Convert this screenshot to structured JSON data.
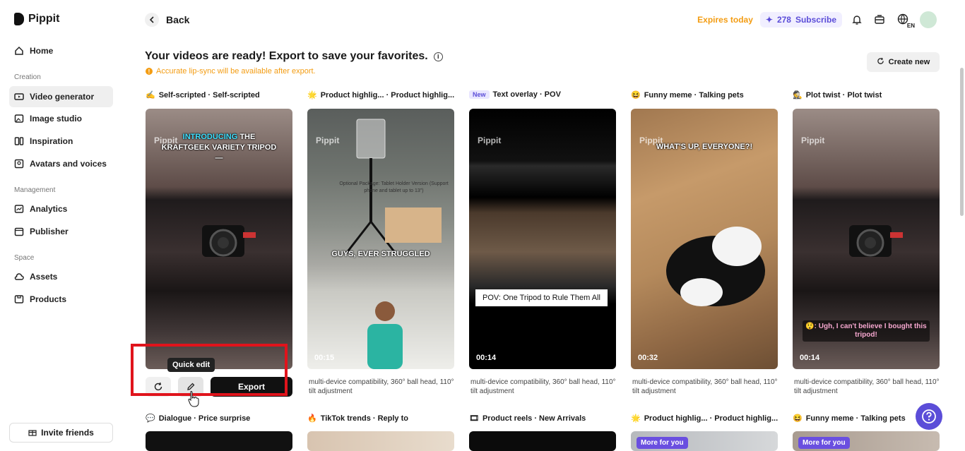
{
  "app": {
    "name": "Pippit"
  },
  "sidebar": {
    "items": [
      {
        "label": "Home"
      },
      {
        "label": "Video generator"
      },
      {
        "label": "Image studio"
      },
      {
        "label": "Inspiration"
      },
      {
        "label": "Avatars and voices"
      },
      {
        "label": "Analytics"
      },
      {
        "label": "Publisher"
      },
      {
        "label": "Assets"
      },
      {
        "label": "Products"
      }
    ],
    "sections": {
      "creation": "Creation",
      "management": "Management",
      "space": "Space"
    },
    "invite_label": "Invite friends"
  },
  "topbar": {
    "back_label": "Back",
    "expires": "Expires today",
    "credits": "278",
    "subscribe": "Subscribe",
    "language": "EN"
  },
  "main": {
    "headline": "Your videos are ready! Export to save your favorites.",
    "warning": "Accurate lip-sync will be available after export.",
    "create_new": "Create new",
    "cards": [
      {
        "emoji": "✍",
        "title": "Self-scripted · Self-scripted",
        "duration": "",
        "overlay": "INTRODUCING THE KRAFTGEEK VARIETY TRIPOD —",
        "highlight": "INTRODUCING"
      },
      {
        "emoji": "🌟",
        "title": "Product highlig... · Product highlig...",
        "duration": "00:15",
        "overlay": "GUYS, EVER STRUGGLED",
        "caption": "multi-device compatibility, 360° ball head, 110° tilt adjustment",
        "package": "Optional Package: Tablet Holder Version (Support phone and tablet up to 13\")"
      },
      {
        "badge": "New",
        "title": "Text overlay · POV",
        "duration": "00:14",
        "overlay": "POV: One Tripod to Rule Them All",
        "caption": "multi-device compatibility, 360° ball head, 110° tilt adjustment"
      },
      {
        "emoji": "😆",
        "title": "Funny meme · Talking pets",
        "duration": "00:32",
        "overlay": "WHAT'S UP, EVERYONE?!",
        "caption": "multi-device compatibility, 360° ball head, 110° tilt adjustment"
      },
      {
        "emoji": "🕵",
        "title": "Plot twist · Plot twist",
        "duration": "00:14",
        "overlay": "😲: Ugh, I can't believe I bought this tripod!",
        "caption": "multi-device compatibility, 360° ball head, 110° tilt adjustment"
      }
    ],
    "second_row": [
      {
        "emoji": "💬",
        "title": "Dialogue · Price surprise"
      },
      {
        "emoji": "🔥",
        "title": "TikTok trends · Reply to"
      },
      {
        "emoji": "🎞",
        "title": "Product reels · New Arrivals"
      },
      {
        "emoji": "🌟",
        "title": "Product highlig... · Product highlig...",
        "more": "More for you"
      },
      {
        "emoji": "😆",
        "title": "Funny meme · Talking pets",
        "more": "More for you"
      }
    ],
    "watermark": "Pippit",
    "export_label": "Export",
    "tooltip": "Quick edit"
  }
}
